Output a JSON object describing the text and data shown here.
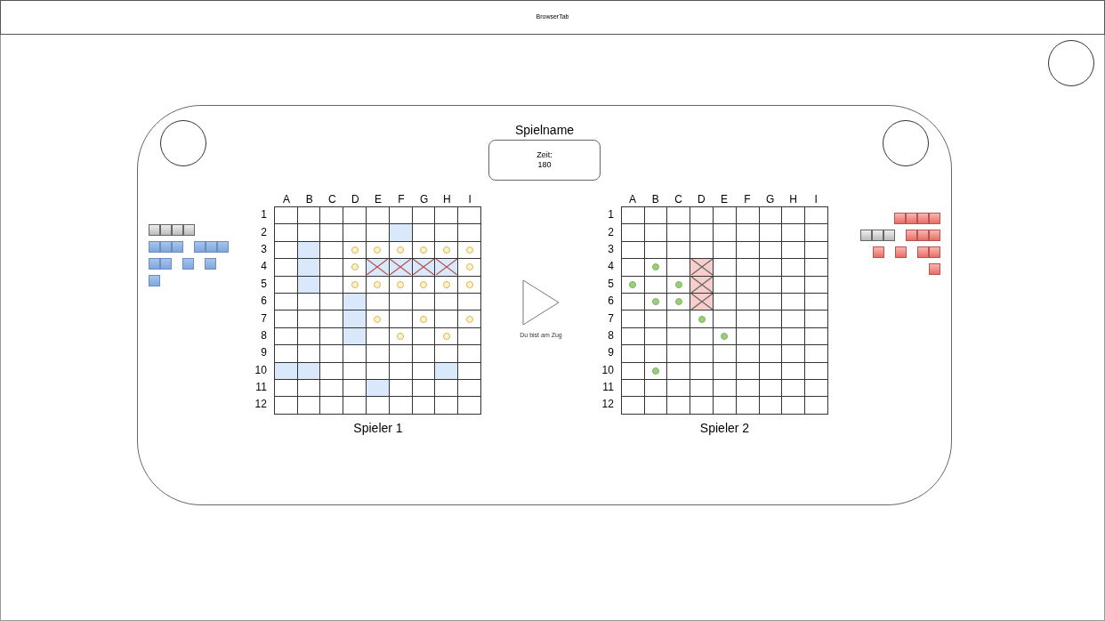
{
  "browser_tab": {
    "title": "BrowserTab"
  },
  "game": {
    "title": "Spielname",
    "timer": {
      "label": "Zeit:",
      "value": "180"
    },
    "turn": {
      "text": "Du bist am Zug"
    }
  },
  "fleets": [
    {
      "kind": "own",
      "rows": [
        [
          {
            "kind": "battleship",
            "sunk": true
          }
        ],
        [
          {
            "kind": "cruiser",
            "sunk": false
          },
          {
            "kind": "cruiser",
            "sunk": false
          }
        ],
        [
          {
            "kind": "destroyer",
            "sunk": false
          },
          {
            "kind": "submarine",
            "sunk": false
          },
          {
            "kind": "submarine",
            "sunk": false
          }
        ],
        [
          {
            "kind": "submarine",
            "sunk": false
          }
        ]
      ]
    },
    {
      "kind": "opponent",
      "rows": [
        [
          {
            "kind": "battleship",
            "sunk": false
          }
        ],
        [
          {
            "kind": "cruiser",
            "sunk": true
          },
          {
            "kind": "cruiser",
            "sunk": false
          }
        ],
        [
          {
            "kind": "submarine",
            "sunk": false
          },
          {
            "kind": "submarine",
            "sunk": false
          },
          {
            "kind": "destroyer",
            "sunk": false
          }
        ],
        [
          {
            "kind": "submarine",
            "sunk": false
          }
        ]
      ]
    }
  ],
  "boards": [
    {
      "kind": "own",
      "player": "Spieler 1",
      "columns": [
        "A",
        "B",
        "C",
        "D",
        "E",
        "F",
        "G",
        "H",
        "I"
      ],
      "rows": [
        {
          "label": "1",
          "cells": [
            {
              "kind": "empty"
            },
            {
              "kind": "empty"
            },
            {
              "kind": "empty"
            },
            {
              "kind": "empty"
            },
            {
              "kind": "empty"
            },
            {
              "kind": "empty"
            },
            {
              "kind": "empty"
            },
            {
              "kind": "empty"
            },
            {
              "kind": "empty"
            }
          ]
        },
        {
          "label": "2",
          "cells": [
            {
              "kind": "empty"
            },
            {
              "kind": "empty"
            },
            {
              "kind": "empty"
            },
            {
              "kind": "empty"
            },
            {
              "kind": "empty"
            },
            {
              "kind": "ship"
            },
            {
              "kind": "empty"
            },
            {
              "kind": "empty"
            },
            {
              "kind": "empty"
            }
          ]
        },
        {
          "label": "3",
          "cells": [
            {
              "kind": "empty"
            },
            {
              "kind": "ship"
            },
            {
              "kind": "empty"
            },
            {
              "kind": "miss"
            },
            {
              "kind": "miss"
            },
            {
              "kind": "miss"
            },
            {
              "kind": "miss"
            },
            {
              "kind": "miss"
            },
            {
              "kind": "miss"
            }
          ]
        },
        {
          "label": "4",
          "cells": [
            {
              "kind": "empty"
            },
            {
              "kind": "ship"
            },
            {
              "kind": "empty"
            },
            {
              "kind": "miss"
            },
            {
              "kind": "hit"
            },
            {
              "kind": "hit"
            },
            {
              "kind": "hit"
            },
            {
              "kind": "hit"
            },
            {
              "kind": "miss"
            }
          ]
        },
        {
          "label": "5",
          "cells": [
            {
              "kind": "empty"
            },
            {
              "kind": "ship"
            },
            {
              "kind": "empty"
            },
            {
              "kind": "miss"
            },
            {
              "kind": "miss"
            },
            {
              "kind": "miss"
            },
            {
              "kind": "miss"
            },
            {
              "kind": "miss"
            },
            {
              "kind": "miss"
            }
          ]
        },
        {
          "label": "6",
          "cells": [
            {
              "kind": "empty"
            },
            {
              "kind": "empty"
            },
            {
              "kind": "empty"
            },
            {
              "kind": "ship"
            },
            {
              "kind": "empty"
            },
            {
              "kind": "empty"
            },
            {
              "kind": "empty"
            },
            {
              "kind": "empty"
            },
            {
              "kind": "empty"
            }
          ]
        },
        {
          "label": "7",
          "cells": [
            {
              "kind": "empty"
            },
            {
              "kind": "empty"
            },
            {
              "kind": "empty"
            },
            {
              "kind": "ship"
            },
            {
              "kind": "miss"
            },
            {
              "kind": "empty"
            },
            {
              "kind": "miss"
            },
            {
              "kind": "empty"
            },
            {
              "kind": "miss"
            }
          ]
        },
        {
          "label": "8",
          "cells": [
            {
              "kind": "empty"
            },
            {
              "kind": "empty"
            },
            {
              "kind": "empty"
            },
            {
              "kind": "ship"
            },
            {
              "kind": "empty"
            },
            {
              "kind": "miss"
            },
            {
              "kind": "empty"
            },
            {
              "kind": "miss"
            },
            {
              "kind": "empty"
            }
          ]
        },
        {
          "label": "9",
          "cells": [
            {
              "kind": "empty"
            },
            {
              "kind": "empty"
            },
            {
              "kind": "empty"
            },
            {
              "kind": "empty"
            },
            {
              "kind": "empty"
            },
            {
              "kind": "empty"
            },
            {
              "kind": "empty"
            },
            {
              "kind": "empty"
            },
            {
              "kind": "empty"
            }
          ]
        },
        {
          "label": "10",
          "cells": [
            {
              "kind": "ship"
            },
            {
              "kind": "ship"
            },
            {
              "kind": "empty"
            },
            {
              "kind": "empty"
            },
            {
              "kind": "empty"
            },
            {
              "kind": "empty"
            },
            {
              "kind": "empty"
            },
            {
              "kind": "ship"
            },
            {
              "kind": "empty"
            }
          ]
        },
        {
          "label": "11",
          "cells": [
            {
              "kind": "empty"
            },
            {
              "kind": "empty"
            },
            {
              "kind": "empty"
            },
            {
              "kind": "empty"
            },
            {
              "kind": "ship"
            },
            {
              "kind": "empty"
            },
            {
              "kind": "empty"
            },
            {
              "kind": "empty"
            },
            {
              "kind": "empty"
            }
          ]
        },
        {
          "label": "12",
          "cells": [
            {
              "kind": "empty"
            },
            {
              "kind": "empty"
            },
            {
              "kind": "empty"
            },
            {
              "kind": "empty"
            },
            {
              "kind": "empty"
            },
            {
              "kind": "empty"
            },
            {
              "kind": "empty"
            },
            {
              "kind": "empty"
            },
            {
              "kind": "empty"
            }
          ]
        }
      ]
    },
    {
      "kind": "opponent",
      "player": "Spieler 2",
      "columns": [
        "A",
        "B",
        "C",
        "D",
        "E",
        "F",
        "G",
        "H",
        "I"
      ],
      "rows": [
        {
          "label": "1",
          "cells": [
            {
              "kind": "empty"
            },
            {
              "kind": "empty"
            },
            {
              "kind": "empty"
            },
            {
              "kind": "empty"
            },
            {
              "kind": "empty"
            },
            {
              "kind": "empty"
            },
            {
              "kind": "empty"
            },
            {
              "kind": "empty"
            },
            {
              "kind": "empty"
            }
          ]
        },
        {
          "label": "2",
          "cells": [
            {
              "kind": "empty"
            },
            {
              "kind": "empty"
            },
            {
              "kind": "empty"
            },
            {
              "kind": "empty"
            },
            {
              "kind": "empty"
            },
            {
              "kind": "empty"
            },
            {
              "kind": "empty"
            },
            {
              "kind": "empty"
            },
            {
              "kind": "empty"
            }
          ]
        },
        {
          "label": "3",
          "cells": [
            {
              "kind": "empty"
            },
            {
              "kind": "empty"
            },
            {
              "kind": "empty"
            },
            {
              "kind": "empty"
            },
            {
              "kind": "empty"
            },
            {
              "kind": "empty"
            },
            {
              "kind": "empty"
            },
            {
              "kind": "empty"
            },
            {
              "kind": "empty"
            }
          ]
        },
        {
          "label": "4",
          "cells": [
            {
              "kind": "empty"
            },
            {
              "kind": "miss"
            },
            {
              "kind": "empty"
            },
            {
              "kind": "hit"
            },
            {
              "kind": "empty"
            },
            {
              "kind": "empty"
            },
            {
              "kind": "empty"
            },
            {
              "kind": "empty"
            },
            {
              "kind": "empty"
            }
          ]
        },
        {
          "label": "5",
          "cells": [
            {
              "kind": "miss"
            },
            {
              "kind": "empty"
            },
            {
              "kind": "miss"
            },
            {
              "kind": "hit"
            },
            {
              "kind": "empty"
            },
            {
              "kind": "empty"
            },
            {
              "kind": "empty"
            },
            {
              "kind": "empty"
            },
            {
              "kind": "empty"
            }
          ]
        },
        {
          "label": "6",
          "cells": [
            {
              "kind": "empty"
            },
            {
              "kind": "miss"
            },
            {
              "kind": "miss"
            },
            {
              "kind": "hit"
            },
            {
              "kind": "empty"
            },
            {
              "kind": "empty"
            },
            {
              "kind": "empty"
            },
            {
              "kind": "empty"
            },
            {
              "kind": "empty"
            }
          ]
        },
        {
          "label": "7",
          "cells": [
            {
              "kind": "empty"
            },
            {
              "kind": "empty"
            },
            {
              "kind": "empty"
            },
            {
              "kind": "miss"
            },
            {
              "kind": "empty"
            },
            {
              "kind": "empty"
            },
            {
              "kind": "empty"
            },
            {
              "kind": "empty"
            },
            {
              "kind": "empty"
            }
          ]
        },
        {
          "label": "8",
          "cells": [
            {
              "kind": "empty"
            },
            {
              "kind": "empty"
            },
            {
              "kind": "empty"
            },
            {
              "kind": "empty"
            },
            {
              "kind": "miss"
            },
            {
              "kind": "empty"
            },
            {
              "kind": "empty"
            },
            {
              "kind": "empty"
            },
            {
              "kind": "empty"
            }
          ]
        },
        {
          "label": "9",
          "cells": [
            {
              "kind": "empty"
            },
            {
              "kind": "empty"
            },
            {
              "kind": "empty"
            },
            {
              "kind": "empty"
            },
            {
              "kind": "empty"
            },
            {
              "kind": "empty"
            },
            {
              "kind": "empty"
            },
            {
              "kind": "empty"
            },
            {
              "kind": "empty"
            }
          ]
        },
        {
          "label": "10",
          "cells": [
            {
              "kind": "empty"
            },
            {
              "kind": "miss"
            },
            {
              "kind": "empty"
            },
            {
              "kind": "empty"
            },
            {
              "kind": "empty"
            },
            {
              "kind": "empty"
            },
            {
              "kind": "empty"
            },
            {
              "kind": "empty"
            },
            {
              "kind": "empty"
            }
          ]
        },
        {
          "label": "11",
          "cells": [
            {
              "kind": "empty"
            },
            {
              "kind": "empty"
            },
            {
              "kind": "empty"
            },
            {
              "kind": "empty"
            },
            {
              "kind": "empty"
            },
            {
              "kind": "empty"
            },
            {
              "kind": "empty"
            },
            {
              "kind": "empty"
            },
            {
              "kind": "empty"
            }
          ]
        },
        {
          "label": "12",
          "cells": [
            {
              "kind": "empty"
            },
            {
              "kind": "empty"
            },
            {
              "kind": "empty"
            },
            {
              "kind": "empty"
            },
            {
              "kind": "empty"
            },
            {
              "kind": "empty"
            },
            {
              "kind": "empty"
            },
            {
              "kind": "empty"
            },
            {
              "kind": "empty"
            }
          ]
        }
      ]
    }
  ]
}
